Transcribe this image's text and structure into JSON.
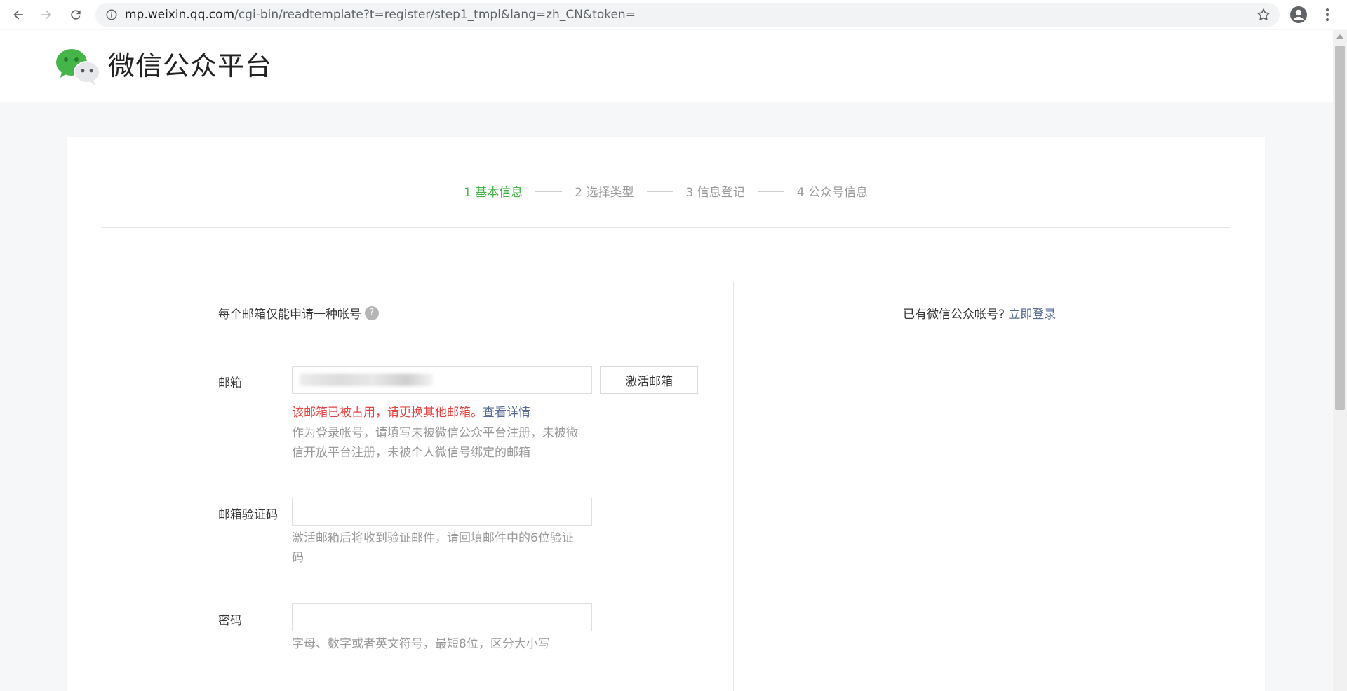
{
  "browser": {
    "url_host": "mp.weixin.qq.com",
    "url_path": "/cgi-bin/readtemplate?t=register/step1_tmpl&lang=zh_CN&token="
  },
  "header": {
    "logo_text": "微信公众平台"
  },
  "steps": [
    {
      "label": "1 基本信息",
      "active": true
    },
    {
      "label": "2 选择类型",
      "active": false
    },
    {
      "label": "3 信息登记",
      "active": false
    },
    {
      "label": "4 公众号信息",
      "active": false
    }
  ],
  "form": {
    "notice": "每个邮箱仅能申请一种帐号",
    "help_glyph": "?",
    "email": {
      "label": "邮箱",
      "activate_button": "激活邮箱",
      "error": "该邮箱已被占用，请更换其他邮箱。",
      "error_link": "查看详情",
      "tip": "作为登录帐号，请填写未被微信公众平台注册，未被微信开放平台注册，未被个人微信号绑定的邮箱"
    },
    "code": {
      "label": "邮箱验证码",
      "tip": "激活邮箱后将收到验证邮件，请回填邮件中的6位验证码"
    },
    "password": {
      "label": "密码",
      "tip": "字母、数字或者英文符号，最短8位，区分大小写"
    }
  },
  "login_hint": {
    "text": "已有微信公众帐号?",
    "link": "立即登录"
  },
  "colors": {
    "active_step": "#44b549",
    "error": "#e64340",
    "link": "#576b95"
  }
}
